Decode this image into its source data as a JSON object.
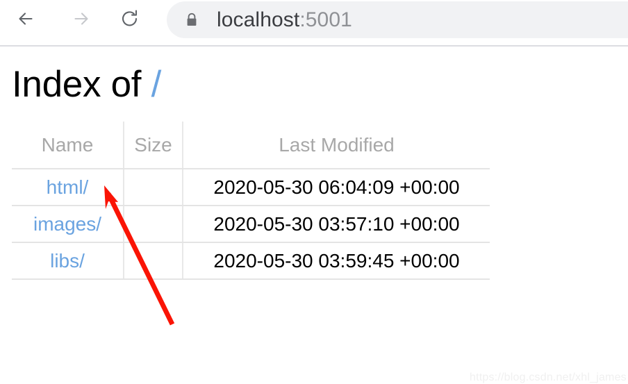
{
  "browser": {
    "nav": {
      "back_icon": "arrow-left-icon",
      "forward_icon": "arrow-right-icon",
      "reload_icon": "reload-icon"
    },
    "address": {
      "lock_icon": "lock-icon",
      "host": "localhost",
      "port": ":5001",
      "full_url": "localhost:5001"
    }
  },
  "page": {
    "title_prefix": "Index of ",
    "root_path": "/",
    "table": {
      "headers": [
        "Name",
        "Size",
        "Last Modified"
      ],
      "rows": [
        {
          "name": "html/",
          "size": "",
          "modified": "2020-05-30 06:04:09 +00:00"
        },
        {
          "name": "images/",
          "size": "",
          "modified": "2020-05-30 03:57:10 +00:00"
        },
        {
          "name": "libs/",
          "size": "",
          "modified": "2020-05-30 03:59:45 +00:00"
        }
      ]
    }
  },
  "annotation": {
    "arrow_color": "#fa1405",
    "arrow_name": "red-pointer-arrow"
  },
  "watermark": {
    "text": "https://blog.csdn.net/xhl_james"
  },
  "colors": {
    "link": "#6aa3e0",
    "header_text": "#a8a8a8",
    "address_bg": "#f1f2f4",
    "border": "#e4e4e4"
  }
}
